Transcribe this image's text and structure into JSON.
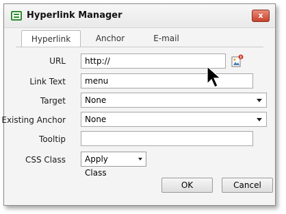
{
  "window": {
    "title": "Hyperlink Manager",
    "close_label": "x"
  },
  "tabs": [
    {
      "label": "Hyperlink",
      "active": true
    },
    {
      "label": "Anchor",
      "active": false
    },
    {
      "label": "E-mail",
      "active": false
    }
  ],
  "form": {
    "url": {
      "label": "URL",
      "value": "http://"
    },
    "link_text": {
      "label": "Link Text",
      "value": "menu"
    },
    "target": {
      "label": "Target",
      "value": "None"
    },
    "existing_anchor": {
      "label": "Existing Anchor",
      "value": "None"
    },
    "tooltip": {
      "label": "Tooltip",
      "value": ""
    },
    "css_class": {
      "label": "CSS Class",
      "value": "Apply Class"
    }
  },
  "buttons": {
    "ok": "OK",
    "cancel": "Cancel"
  },
  "icons": {
    "app": "hyperlink-manager-icon",
    "browse": "image-browse-icon",
    "cursor": "mouse-pointer"
  },
  "colors": {
    "close_button": "#c9432d",
    "app_icon": "#2e8b2e"
  }
}
